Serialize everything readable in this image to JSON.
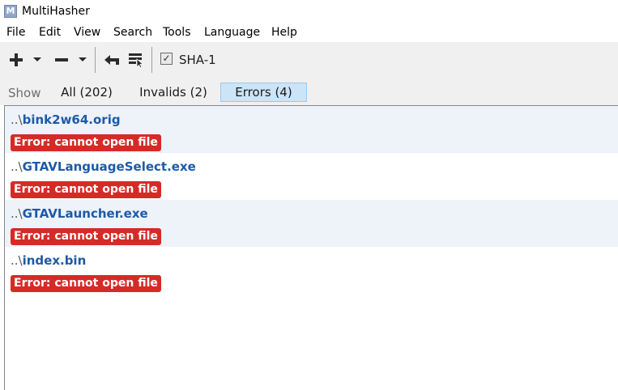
{
  "window": {
    "title": "MultiHasher",
    "icon": "app-logo-icon"
  },
  "menu": [
    "File",
    "Edit",
    "View",
    "Search",
    "Tools",
    "Language",
    "Help"
  ],
  "toolbar": {
    "buttons": [
      "add-icon",
      "remove-icon",
      "undo-icon",
      "verify-icon"
    ],
    "checkbox_label": "SHA-1",
    "checkbox_checked": true
  },
  "filters": {
    "show_label": "Show",
    "tabs": [
      {
        "label": "All (202)",
        "active": false
      },
      {
        "label": "Invalids (2)",
        "active": false
      },
      {
        "label": "Errors (4)",
        "active": true
      }
    ]
  },
  "files": [
    {
      "prefix": "..\\",
      "name": "bink2w64.orig",
      "error": "Error: cannot open file"
    },
    {
      "prefix": "..\\",
      "name": "GTAVLanguageSelect.exe",
      "error": "Error: cannot open file"
    },
    {
      "prefix": "..\\",
      "name": "GTAVLauncher.exe",
      "error": "Error: cannot open file"
    },
    {
      "prefix": "..\\",
      "name": "index.bin",
      "error": "Error: cannot open file"
    }
  ],
  "colors": {
    "path": "#1d5aa8",
    "error_badge": "#d52b26",
    "active_tab": "#cce4f7",
    "alt_row": "#eef2f9"
  }
}
